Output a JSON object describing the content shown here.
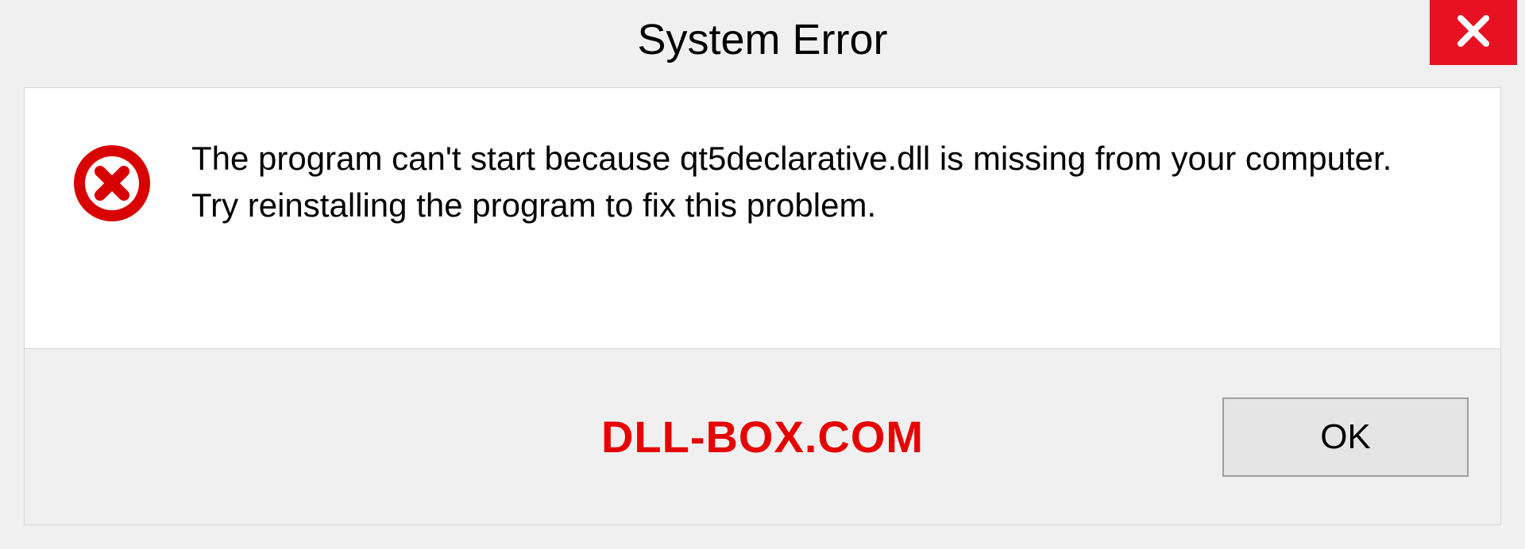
{
  "titlebar": {
    "title": "System Error"
  },
  "content": {
    "message": "The program can't start because qt5declarative.dll is missing from your computer. Try reinstalling the program to fix this problem."
  },
  "footer": {
    "watermark": "DLL-BOX.COM",
    "ok_label": "OK"
  },
  "colors": {
    "close_bg": "#e81123",
    "error_icon": "#d80000",
    "watermark": "#e60000"
  }
}
